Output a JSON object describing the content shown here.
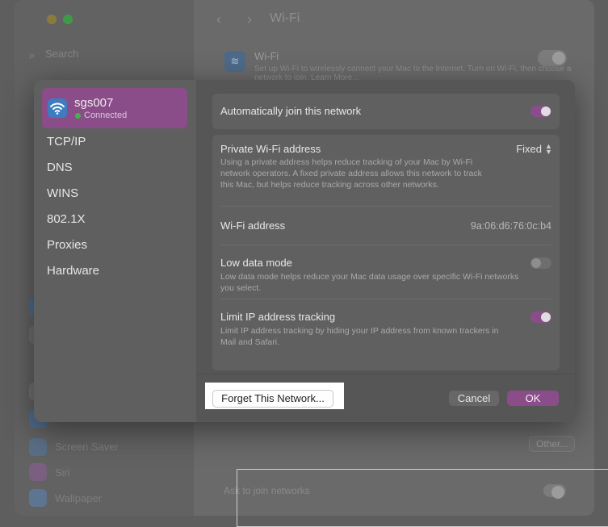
{
  "background_window": {
    "title": "Wi-Fi",
    "search_placeholder": "Search",
    "wifi_section_title": "Wi-Fi",
    "wifi_section_desc": "Set up Wi-Fi to wirelessly connect your Mac to the Internet. Turn on Wi-Fi, then choose a network to join. Learn More...",
    "sidebar_items": [
      "Screen Saver",
      "Siri",
      "Wallpaper"
    ],
    "other_button": "Other...",
    "ask_to_join": "Ask to join networks"
  },
  "sheet": {
    "network": {
      "name": "sgs007",
      "status": "Connected"
    },
    "sidebar_items": [
      "TCP/IP",
      "DNS",
      "WINS",
      "802.1X",
      "Proxies",
      "Hardware"
    ],
    "auto_join": {
      "label": "Automatically join this network",
      "enabled": true
    },
    "private_address": {
      "label": "Private Wi-Fi address",
      "value": "Fixed",
      "description": "Using a private address helps reduce tracking of your Mac by Wi-Fi network operators. A fixed private address allows this network to track this Mac, but helps reduce tracking across other networks."
    },
    "wifi_address": {
      "label": "Wi-Fi address",
      "value": "9a:06:d6:76:0c:b4"
    },
    "low_data": {
      "label": "Low data mode",
      "description": "Low data mode helps reduce your Mac data usage over specific Wi-Fi networks you select.",
      "enabled": false
    },
    "limit_ip": {
      "label": "Limit IP address tracking",
      "description": "Limit IP address tracking by hiding your IP address from known trackers in Mail and Safari.",
      "enabled": true
    },
    "buttons": {
      "forget": "Forget This Network...",
      "cancel": "Cancel",
      "ok": "OK"
    }
  },
  "colors": {
    "accent": "#8b4d8a",
    "connected_dot": "#46b24a",
    "wifi_icon": "#3c7dc1"
  }
}
